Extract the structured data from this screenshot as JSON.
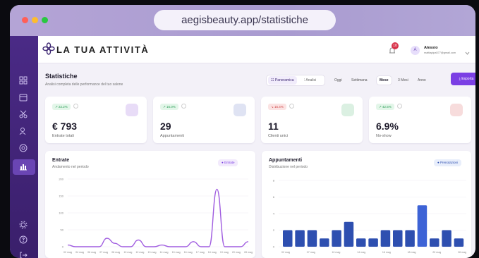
{
  "browser": {
    "url": "aegisbeauty.app/statistiche"
  },
  "header": {
    "brand": "LA TUA ATTIVITÀ",
    "notification_count": "10",
    "user_initial": "A",
    "user_name": "Alessio",
    "user_email": "mattiapipa577@gmail.com"
  },
  "page": {
    "title": "Statistiche",
    "subtitle": "Analisi completa delle performance del tuo salone"
  },
  "view_tabs": {
    "overview": "Panoramica",
    "analysis": "Analisi"
  },
  "periods": [
    "Oggi",
    "Settimana",
    "Mese",
    "3 Mesi",
    "Anno"
  ],
  "active_period": "Mese",
  "export_label": "Esporta",
  "kpis": [
    {
      "badge": "↗ 22.2%",
      "value": "€ 793",
      "label": "Entrate totali",
      "trend_color": "#2a9d55",
      "badge_bg": "#e3f6e9",
      "deco": "#e8dcf7"
    },
    {
      "badge": "↗ 16.0%",
      "value": "29",
      "label": "Appuntamenti",
      "trend_color": "#2a9d55",
      "badge_bg": "#e3f6e9",
      "deco": "#dfe3f3"
    },
    {
      "badge": "↘ 15.4%",
      "value": "11",
      "label": "Clienti unici",
      "trend_color": "#d04545",
      "badge_bg": "#fbe3e3",
      "deco": "#dbf0e2"
    },
    {
      "badge": "↗ 42.5%",
      "value": "6.9%",
      "label": "No-show",
      "trend_color": "#2a9d55",
      "badge_bg": "#e3f6e9",
      "deco": "#f7dcdc"
    }
  ],
  "revenue_card": {
    "title": "Entrate",
    "subtitle": "Andamento nel periodo",
    "legend": "Entrate"
  },
  "appointments_card": {
    "title": "Appuntamenti",
    "subtitle": "Distribuzione nel periodo",
    "legend": "Prenotazioni"
  },
  "colors": {
    "accent": "#7b3fe4",
    "line": "#a05de0",
    "bar": "#2e4fb0",
    "bar_peak": "#3d63d6"
  },
  "chart_data": [
    {
      "type": "line",
      "title": "Entrate",
      "series": [
        {
          "name": "Entrate",
          "values": [
            5,
            0,
            0,
            0,
            0,
            25,
            10,
            0,
            0,
            20,
            0,
            0,
            5,
            0,
            0,
            0,
            15,
            0,
            0,
            170,
            0,
            0,
            0,
            15
          ]
        }
      ],
      "y_ticks": [
        "200",
        "150",
        "100",
        "50",
        "0"
      ],
      "ylim": [
        0,
        200
      ],
      "x_tick_labels": [
        "02 mag",
        "04 mag",
        "06 mag",
        "07 mag",
        "08 mag",
        "10 mag",
        "12 mag",
        "13 mag",
        "14 mag",
        "15 mag",
        "16 mag",
        "17 mag",
        "18 mag",
        "19 mag",
        "20 mag",
        "28 mag"
      ]
    },
    {
      "type": "bar",
      "title": "Appuntamenti",
      "series": [
        {
          "name": "Prenotazioni",
          "values": [
            2,
            2,
            2,
            1,
            2,
            3,
            1,
            1,
            2,
            2,
            2,
            5,
            1,
            2,
            1
          ]
        }
      ],
      "y_ticks": [
        "8",
        "6",
        "4",
        "2",
        "0"
      ],
      "ylim": [
        0,
        8
      ],
      "x_tick_labels": [
        "02 mag",
        "07 mag",
        "10 mag",
        "14 mag",
        "16 mag",
        "18 mag",
        "20 mag",
        "28 mag"
      ]
    }
  ]
}
